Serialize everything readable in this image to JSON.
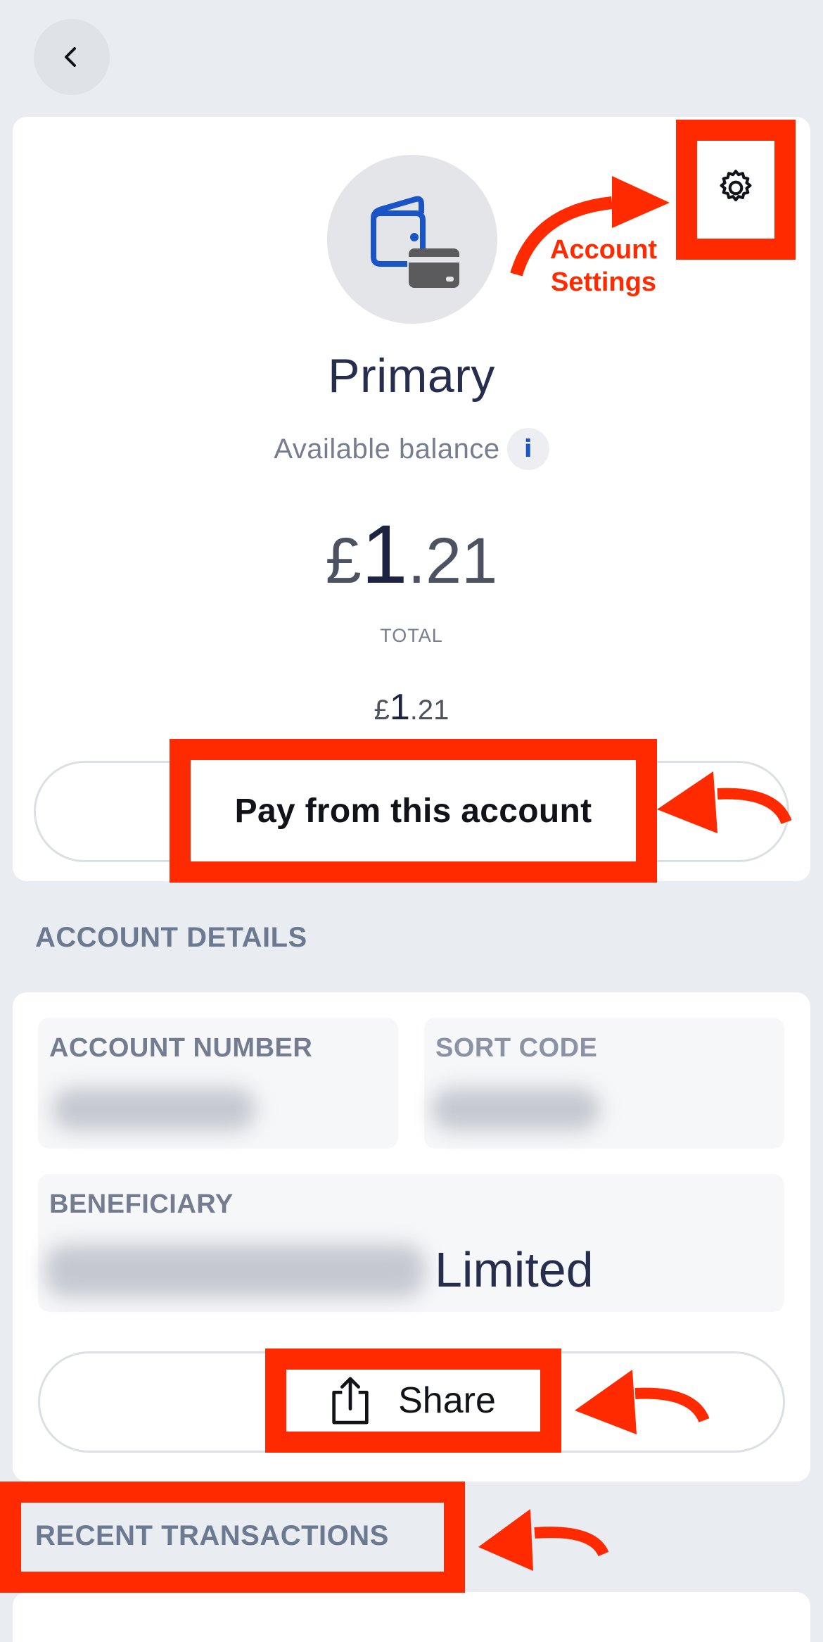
{
  "header": {
    "back_icon": "chevron-left-icon"
  },
  "account": {
    "icon": "wallet-card-icon",
    "settings_icon": "gear-icon",
    "name": "Primary",
    "available_balance_label": "Available balance",
    "info_icon_label": "i",
    "balance": {
      "currency": "£",
      "major": "1",
      "minor": ".21"
    },
    "total_label": "TOTAL",
    "total": {
      "currency": "£",
      "major": "1",
      "minor": ".21"
    },
    "pay_button_label": "Pay from this account"
  },
  "account_details": {
    "section_title": "ACCOUNT DETAILS",
    "account_number_label": "ACCOUNT NUMBER",
    "account_number_value": "",
    "sort_code_label": "SORT CODE",
    "sort_code_value": "",
    "beneficiary_label": "BENEFICIARY",
    "beneficiary_value_visible": "Limited",
    "share_button_label": "Share",
    "share_icon": "share-icon"
  },
  "recent_transactions": {
    "section_title": "RECENT TRANSACTIONS"
  },
  "annotations": {
    "settings_callout": [
      "Account",
      "Settings"
    ],
    "highlight_color": "#ff2a00"
  },
  "colors": {
    "background": "#e9ecf1",
    "card": "#ffffff",
    "accent_blue": "#1a55c8",
    "text_dark": "#262d4d",
    "text_muted": "#777d90",
    "section_title": "#6b7a90"
  }
}
